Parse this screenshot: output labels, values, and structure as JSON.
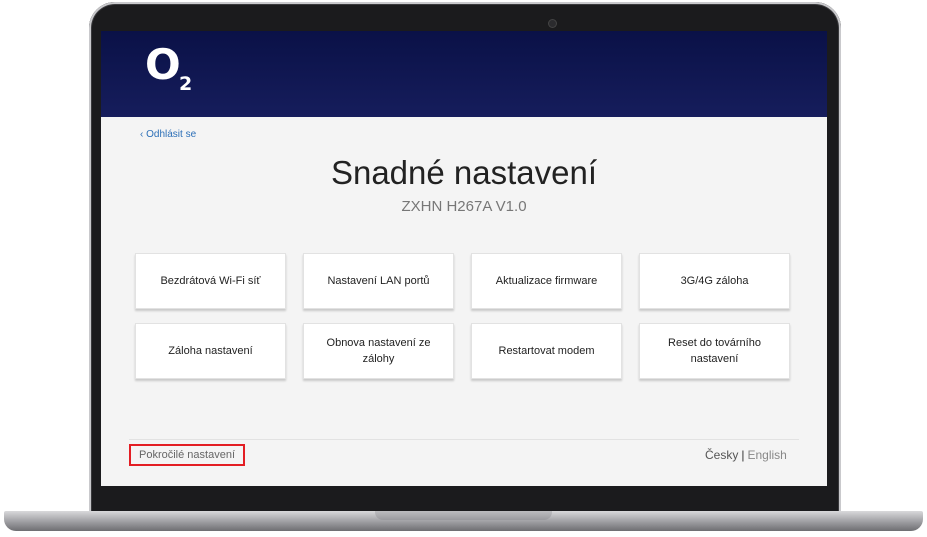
{
  "header": {
    "logo_letter": "O",
    "logo_sub": "2"
  },
  "nav": {
    "logout_label": "‹ Odhlásit se"
  },
  "main": {
    "title": "Snadné nastavení",
    "subtitle": "ZXHN H267A V1.0",
    "tiles": [
      "Bezdrátová Wi-Fi síť",
      "Nastavení LAN portů",
      "Aktualizace firmware",
      "3G/4G záloha",
      "Záloha nastavení",
      "Obnova nastavení ze zálohy",
      "Restartovat modem",
      "Reset do továrního nastavení"
    ]
  },
  "footer": {
    "advanced_label": "Pokročilé nastavení",
    "lang_cz": "Česky",
    "lang_sep": "|",
    "lang_en": "English"
  },
  "colors": {
    "header": "#0a1147",
    "highlight": "#e31e24",
    "link": "#2c6fb7"
  }
}
